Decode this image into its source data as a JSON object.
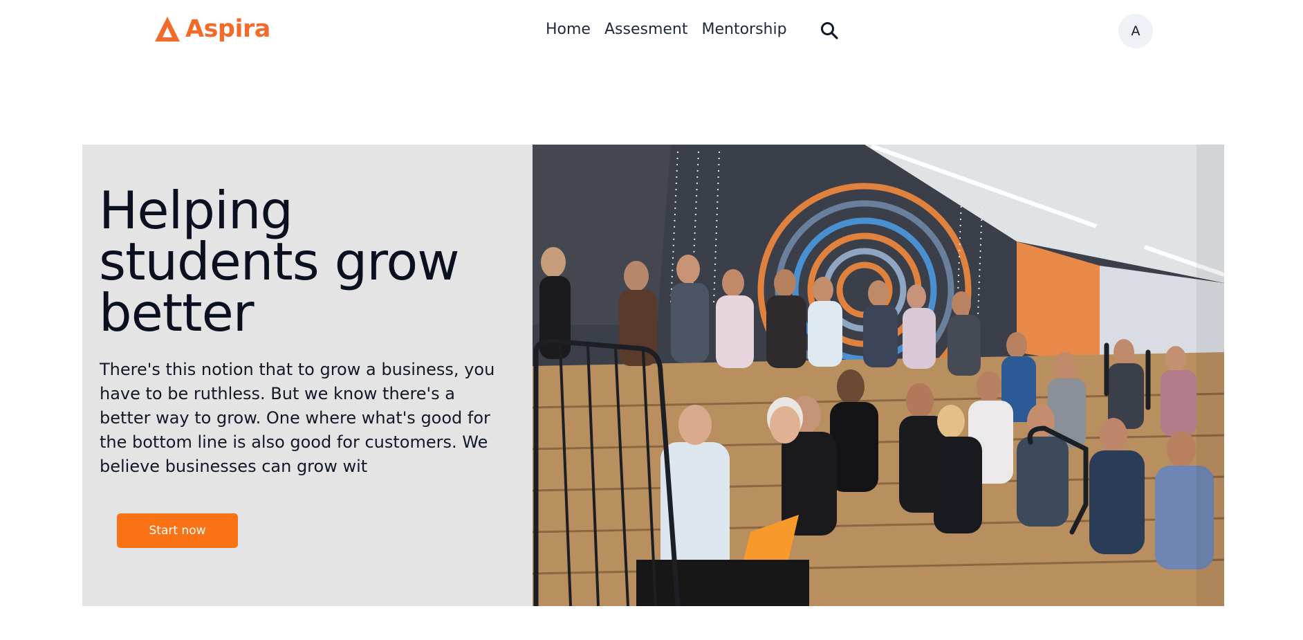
{
  "brand": {
    "name": "Aspira",
    "color": "#f26b2a"
  },
  "nav": {
    "links": [
      "Home",
      "Assesment",
      "Mentorship"
    ],
    "search_icon": "search-icon"
  },
  "user": {
    "avatar_initial": "A"
  },
  "hero": {
    "title": "Helping students grow better",
    "body": "There's this notion that to grow a business, you have to be ruthless. But we know there's a better way to grow. One where what's good for the bottom line is also good for customers. We believe businesses can grow wit",
    "cta_label": "Start now",
    "cta_color": "#f97316",
    "image": "photo of students seated on bleacher steps in a lecture hall"
  }
}
